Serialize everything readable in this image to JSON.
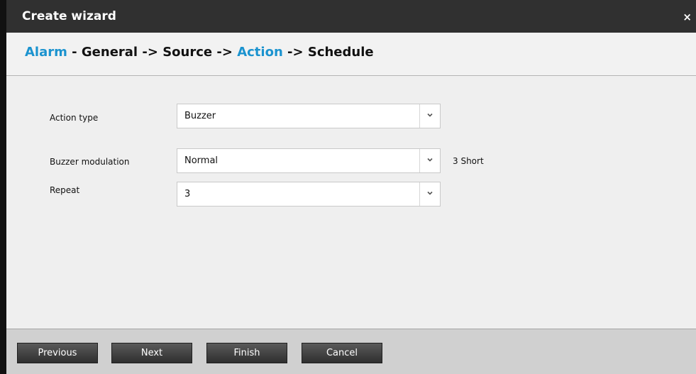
{
  "dialog": {
    "title": "Create wizard",
    "close_label": "×"
  },
  "breadcrumb": {
    "step_alarm": "Alarm",
    "sep_dash": " - ",
    "step_general": "General",
    "arrow1": " -> ",
    "step_source": "Source",
    "arrow2": " -> ",
    "step_action": "Action",
    "arrow3": " -> ",
    "step_schedule": "Schedule"
  },
  "form": {
    "action_type": {
      "label": "Action type",
      "value": "Buzzer"
    },
    "buzzer_modulation": {
      "label": "Buzzer modulation",
      "value": "Normal",
      "note": "3 Short"
    },
    "repeat": {
      "label": "Repeat",
      "value": "3"
    }
  },
  "footer": {
    "previous_label": "Previous",
    "next_label": "Next",
    "finish_label": "Finish",
    "cancel_label": "Cancel"
  },
  "colors": {
    "title_bar": "#303030",
    "accent": "#1b93cf",
    "panel_bg": "#efefef",
    "footer_bg": "#d0d0d0",
    "button_bg": "#3f3f3f"
  },
  "icons": {
    "close": "close-icon",
    "dropdown": "chevron-down-icon"
  }
}
